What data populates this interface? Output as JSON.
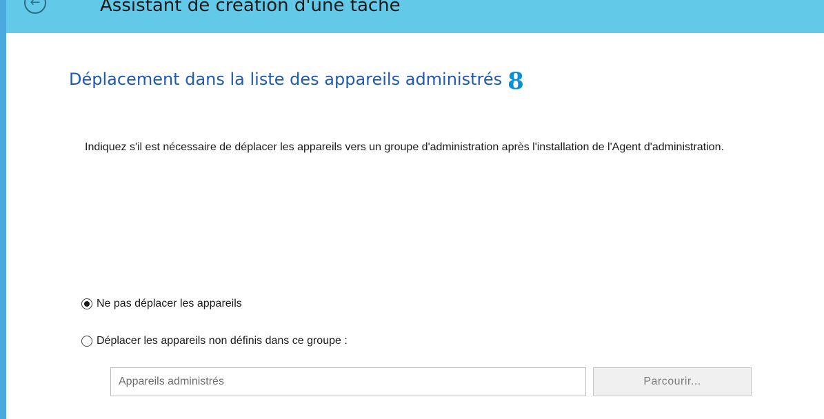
{
  "window": {
    "title": "Assistant de création d'une tâche",
    "back_icon": "back-arrow-icon"
  },
  "page": {
    "title": "Déplacement dans la liste des appareils administrés",
    "step_number": "8",
    "description": "Indiquez s'il est nécessaire de déplacer les appareils vers un groupe d'administration après l'installation de l'Agent d'administration."
  },
  "options": [
    {
      "label": "Ne pas déplacer les appareils",
      "checked": true
    },
    {
      "label": "Déplacer les appareils non définis dans ce groupe :",
      "checked": false
    }
  ],
  "group_field": {
    "value": "Appareils administrés",
    "enabled": false
  },
  "browse_button": {
    "label": "Parcourir..."
  },
  "colors": {
    "titlebar": "#62c9e8",
    "page_title": "#1f59b8",
    "step_number": "#0a8fd6"
  }
}
